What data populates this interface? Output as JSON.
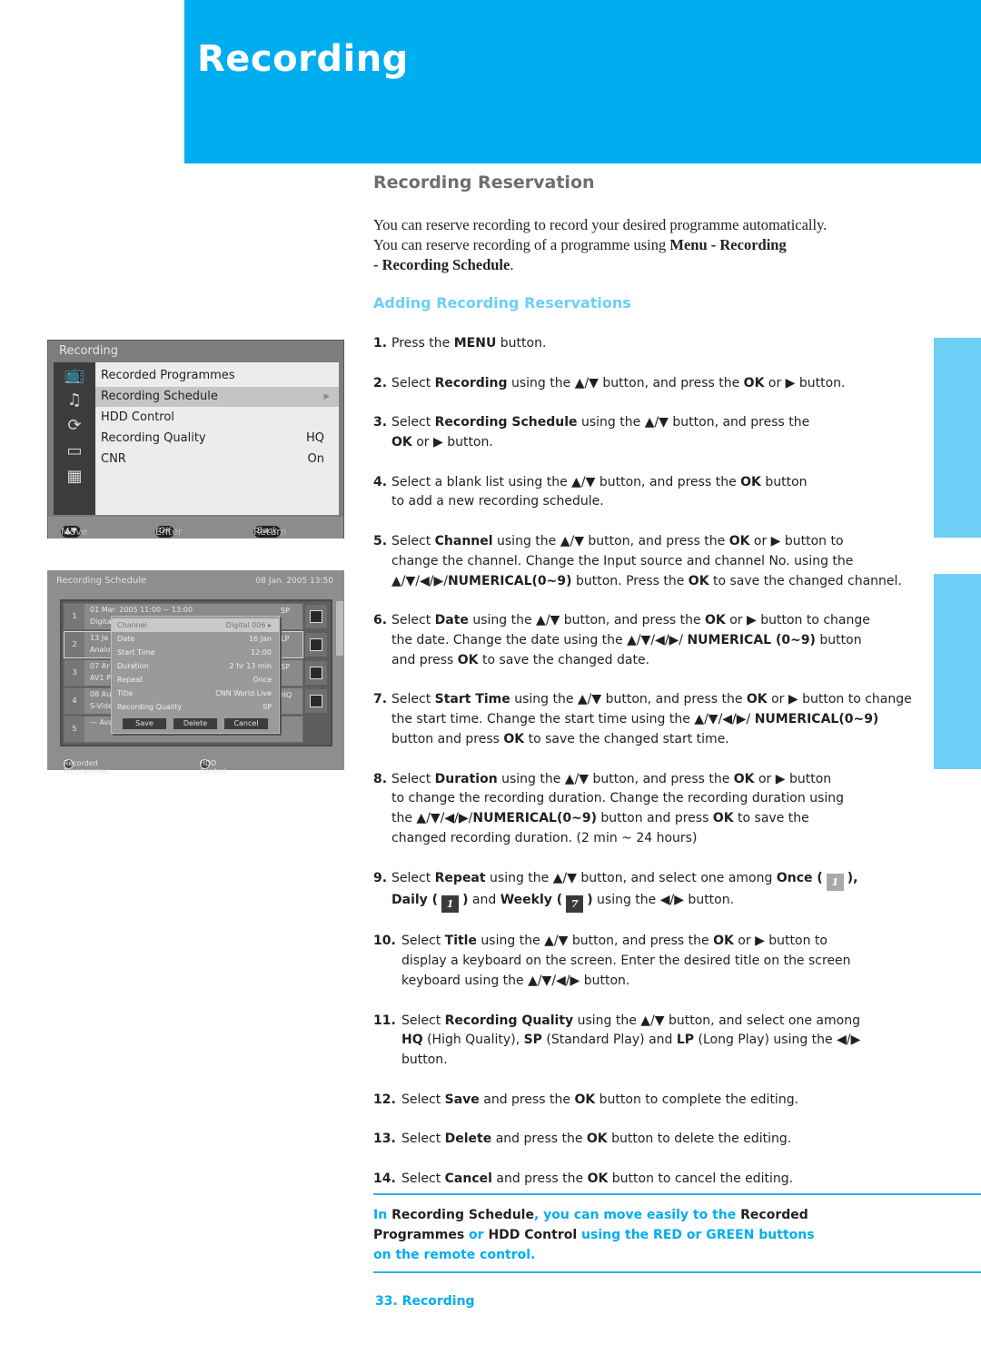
{
  "header": {
    "title": "Recording"
  },
  "section": {
    "title": "Recording Reservation",
    "intro_line1": "You can reserve recording to record your desired programme automatically.",
    "intro_line2_pre": "You can reserve recording of  a programme using  ",
    "intro_line2_bold": "Menu - Recording",
    "intro_line3_bold": "- Recording Schedule",
    "intro_line3_end": ".",
    "subtitle": "Adding Recording Reservations"
  },
  "arrows": {
    "ud": "▲/▼",
    "all": "▲/▼/◀/▶",
    "lr": "◀/▶",
    "right": "▶"
  },
  "steps": [
    {
      "num": "1.",
      "parts": [
        [
          "Press the ",
          ""
        ],
        [
          "MENU",
          "b"
        ],
        [
          " button.",
          ""
        ]
      ]
    },
    {
      "num": "2.",
      "parts": [
        [
          "Select ",
          ""
        ],
        [
          "Recording",
          "b"
        ],
        [
          " using the ▲/▼ button, and press the ",
          ""
        ],
        [
          "OK",
          "b"
        ],
        [
          " or ▶ button.",
          ""
        ]
      ]
    },
    {
      "num": "3.",
      "parts": [
        [
          "Select ",
          ""
        ],
        [
          "Recording Schedule",
          "b"
        ],
        [
          " using the ▲/▼ button, and press the ",
          ""
        ],
        [
          "br",
          "br"
        ],
        [
          "OK",
          "b"
        ],
        [
          " or ▶ button.",
          ""
        ]
      ]
    },
    {
      "num": "4.",
      "parts": [
        [
          "Select a blank list using the ▲/▼ button, and press the ",
          ""
        ],
        [
          "OK",
          "b"
        ],
        [
          " button",
          ""
        ],
        [
          "br",
          "br"
        ],
        [
          "to add a new recording schedule.",
          ""
        ]
      ]
    },
    {
      "num": "5.",
      "parts": [
        [
          "Select ",
          ""
        ],
        [
          "Channel",
          "b"
        ],
        [
          " using the ▲/▼ button, and press the ",
          ""
        ],
        [
          "OK",
          "b"
        ],
        [
          " or ▶ button to",
          ""
        ],
        [
          "br",
          "br"
        ],
        [
          "change the channel. Change the Input source and channel No. using the",
          ""
        ],
        [
          "br",
          "br"
        ],
        [
          "▲/▼/◀/▶/",
          ""
        ],
        [
          "NUMERICAL(0~9)",
          "b"
        ],
        [
          " button. Press the ",
          ""
        ],
        [
          "OK",
          "b"
        ],
        [
          " to save the changed channel.",
          ""
        ]
      ]
    },
    {
      "num": "6.",
      "parts": [
        [
          "Select ",
          ""
        ],
        [
          "Date",
          "b"
        ],
        [
          " using the ▲/▼ button, and press the ",
          ""
        ],
        [
          "OK",
          "b"
        ],
        [
          " or ▶ button to change",
          ""
        ],
        [
          "br",
          "br"
        ],
        [
          "the date. Change the date using the ▲/▼/◀/▶/ ",
          ""
        ],
        [
          "NUMERICAL (0~9)",
          "b"
        ],
        [
          " button",
          ""
        ],
        [
          "br",
          "br"
        ],
        [
          "and press ",
          ""
        ],
        [
          "OK",
          "b"
        ],
        [
          " to save the changed date.",
          ""
        ]
      ]
    },
    {
      "num": "7.",
      "parts": [
        [
          "Select ",
          ""
        ],
        [
          "Start Time",
          "b"
        ],
        [
          " using the ▲/▼ button, and press the ",
          ""
        ],
        [
          "OK",
          "b"
        ],
        [
          " or ▶ button to change",
          ""
        ],
        [
          "br",
          "br"
        ],
        [
          "the start time. Change the start time using the ▲/▼/◀/▶/ ",
          ""
        ],
        [
          "NUMERICAL(0~9)",
          "b"
        ],
        [
          "br",
          "br"
        ],
        [
          "button and press ",
          ""
        ],
        [
          "OK",
          "b"
        ],
        [
          " to save the changed start time.",
          ""
        ]
      ]
    },
    {
      "num": "8.",
      "parts": [
        [
          "Select ",
          ""
        ],
        [
          "Duration",
          "b"
        ],
        [
          " using the ▲/▼ button, and press the ",
          ""
        ],
        [
          "OK",
          "b"
        ],
        [
          " or ▶ button",
          ""
        ],
        [
          "br",
          "br"
        ],
        [
          "to change the recording duration. Change the recording duration using",
          ""
        ],
        [
          "br",
          "br"
        ],
        [
          "the ▲/▼/◀/▶/",
          ""
        ],
        [
          "NUMERICAL(0~9)",
          "b"
        ],
        [
          " button and press ",
          ""
        ],
        [
          "OK",
          "b"
        ],
        [
          " to save the",
          ""
        ],
        [
          "br",
          "br"
        ],
        [
          "changed recording duration. (2 min ~ 24 hours)",
          ""
        ]
      ]
    },
    {
      "num": "9.",
      "parts": [
        [
          "Select ",
          ""
        ],
        [
          "Repeat",
          "b"
        ],
        [
          " using the ▲/▼ button, and select one among ",
          ""
        ],
        [
          "Once (",
          "b"
        ],
        [
          "once",
          "icon"
        ],
        [
          "),",
          "b"
        ],
        [
          "br",
          "br"
        ],
        [
          "Daily (",
          "b"
        ],
        [
          "daily",
          "icon"
        ],
        [
          ")",
          "b"
        ],
        [
          " and ",
          ""
        ],
        [
          "Weekly (",
          "b"
        ],
        [
          "weekly",
          "icon"
        ],
        [
          ")",
          "b"
        ],
        [
          " using the ◀/▶ button.",
          ""
        ]
      ]
    },
    {
      "num": "10.",
      "parts": [
        [
          "Select ",
          ""
        ],
        [
          "Title",
          "b"
        ],
        [
          " using the ▲/▼ button, and press the ",
          ""
        ],
        [
          "OK",
          "b"
        ],
        [
          " or ▶ button to",
          ""
        ],
        [
          "br",
          "br"
        ],
        [
          "display a keyboard on the screen. Enter the desired title on the screen",
          ""
        ],
        [
          "br",
          "br"
        ],
        [
          "keyboard using the ▲/▼/◀/▶ button.",
          ""
        ]
      ]
    },
    {
      "num": "11.",
      "parts": [
        [
          "Select ",
          ""
        ],
        [
          "Recording Quality",
          "b"
        ],
        [
          " using the ▲/▼ button, and select one among",
          ""
        ],
        [
          "br",
          "br"
        ],
        [
          "HQ",
          "b"
        ],
        [
          " (High Quality), ",
          ""
        ],
        [
          "SP",
          "b"
        ],
        [
          " (Standard Play) and ",
          ""
        ],
        [
          "LP",
          "b"
        ],
        [
          " (Long Play) using the ◀/▶",
          ""
        ],
        [
          "br",
          "br"
        ],
        [
          "button.",
          ""
        ]
      ]
    },
    {
      "num": "12.",
      "parts": [
        [
          "Select ",
          ""
        ],
        [
          "Save",
          "b"
        ],
        [
          " and press the ",
          ""
        ],
        [
          "OK",
          "b"
        ],
        [
          " button to complete the editing.",
          ""
        ]
      ]
    },
    {
      "num": "13.",
      "parts": [
        [
          "Select ",
          ""
        ],
        [
          "Delete",
          "b"
        ],
        [
          " and press the ",
          ""
        ],
        [
          "OK",
          "b"
        ],
        [
          " button to delete the editing.",
          ""
        ]
      ]
    },
    {
      "num": "14.",
      "parts": [
        [
          "Select ",
          ""
        ],
        [
          "Cancel",
          "b"
        ],
        [
          " and press the ",
          ""
        ],
        [
          "OK",
          "b"
        ],
        [
          " button to cancel the editing.",
          ""
        ]
      ]
    }
  ],
  "repeat_icons": {
    "once": "1",
    "daily": "1",
    "weekly": "7"
  },
  "note": {
    "parts": [
      [
        "In ",
        "c"
      ],
      [
        "Recording Schedule",
        "d"
      ],
      [
        ", you can move easily to the ",
        "c"
      ],
      [
        "Recorded",
        "d"
      ],
      [
        "br",
        "br"
      ],
      [
        "Programmes",
        "d"
      ],
      [
        " or ",
        "c"
      ],
      [
        "HDD Control",
        "d"
      ],
      [
        " using the RED or GREEN buttons",
        "c"
      ],
      [
        "br",
        "br"
      ],
      [
        "on the remote control.",
        "c"
      ]
    ]
  },
  "footer": {
    "page_label": "33. Recording"
  },
  "screen1": {
    "title": "Recording",
    "items": [
      {
        "label": "Recorded Programmes",
        "value": ""
      },
      {
        "label": "Recording Schedule",
        "value": "▸"
      },
      {
        "label": "HDD Control",
        "value": ""
      },
      {
        "label": "Recording Quality",
        "value": "HQ"
      },
      {
        "label": "CNR",
        "value": "On"
      }
    ],
    "icons": [
      "📺",
      "♫",
      "⟳",
      "▭",
      "▦"
    ],
    "footer": {
      "move": "Move",
      "enter": "Enter",
      "back": "Return",
      "ok_pill": "OK",
      "back_pill": "Back",
      "updown_pill": "▲▼"
    }
  },
  "screen2": {
    "title": "Recording Schedule",
    "datetime": "08 Jan. 2005 13:50",
    "rows": [
      {
        "n": "1",
        "l1": "01 Mar. 2005  11:00 ~ 13:00",
        "l2": "Digital",
        "q": "SP"
      },
      {
        "n": "2",
        "l1": "13 Ja",
        "l2": "Analo",
        "q": "LP"
      },
      {
        "n": "3",
        "l1": "07 Ar",
        "l2": "AV1 P",
        "q": "SP"
      },
      {
        "n": "4",
        "l1": "08 Au",
        "l2": "S-Vide",
        "q": "HQ"
      },
      {
        "n": "5",
        "l1": "— Ava",
        "l2": "",
        "q": ""
      }
    ],
    "popup": {
      "fields": [
        {
          "label": "Channel",
          "value": "Digital   006 ▸"
        },
        {
          "label": "Date",
          "value": "16 Jan"
        },
        {
          "label": "Start Time",
          "value": "12:00"
        },
        {
          "label": "Duration",
          "value": "2 hr 13 min"
        },
        {
          "label": "Repeat",
          "value": "Once"
        },
        {
          "label": "Title",
          "value": "CNN World Live"
        },
        {
          "label": "Recording Quality",
          "value": "SP"
        }
      ],
      "buttons": [
        "Save",
        "Delete",
        "Cancel"
      ]
    },
    "footer": {
      "red": "Recorded Programmes",
      "green": "HDD Control"
    }
  }
}
